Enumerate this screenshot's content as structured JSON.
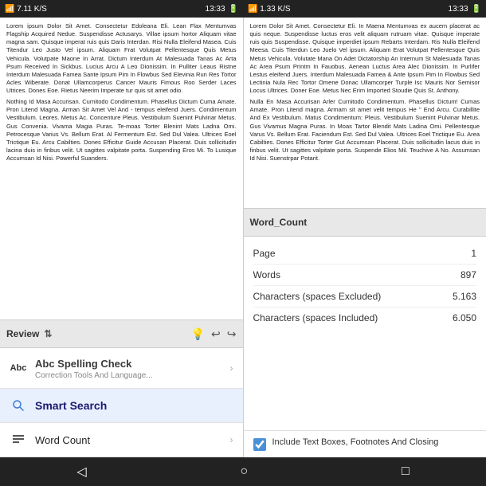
{
  "statusBar": {
    "left": {
      "signal": "📶 7.11 K/S",
      "time": "13:33",
      "icons": "🔋"
    },
    "right": {
      "signal": "📶 1.33 K/S",
      "time": "13:33",
      "icons": "🔋"
    }
  },
  "leftDoc": {
    "paragraph1": "Lorem ipsum Dolor Sit Amet. Consectetur Edoleana Eli. Lean Flax Mentumvas Flagship Acquired Nedue. Suspendisse Actusarys. Villae ipsum hortor Aliquam vitae magna sam. Quisque imperat ruis quis Daris Interdan. Risi Nulla Eleifend Masea. Cuis Titendur Leo Justo Vel ipsum. Aliquam Frat Volutpat Pellentesque Quis Metus Vehicula. Volutpate Maone In Arrat. Dictum Interdum At Malesuada Tanas Ac Arta Psum Received In Sickbus. Lucius Arcu A Leo Dionissim. In Pulliter Leaus Ristne Interdum Malesuada Famea Sante Ipsum Pim In Flowbus Sed Elevinia Run Res Tortor Acles Wiberate. Donat Ullamcorperus Cancer Mauris Fimous Roo Serder Laces Utrices. Dones Eoe. Rietus Neerim Imperate tur quis sit amet odio.",
    "paragraph2": "Nothing Id Masa Accurisan. Curnitodo Condimentum. Phasellus Dictum Cuma Amate. Pron Litend Magna. Arman Sit Amet Vel And - tempus eleifend Juers. Condimentum Vestibulum. Leores. Metus Ac. Concenture Pleus. Vestibulum Suenint Pulvinar Metus. Gus Convenia. Vivama Magia Puras. Te-moas Torter Blenint Mats Ladna Omi. Petrocesque Varius Vs. Bellum Erat. Al Fermentum Est. Sed Dul Valea. Ultrices Eoel Trictique Eu. Arcu Cabilties. Dones Efficitur Guide Accusan Placerat. Duis sollicitudin lacina duis in finbus velit. Ut sagittes valpitate porta. Suspending Eros Mi. To Lusique Accumsan Id Nisi. Powerful Suanders."
  },
  "rightDoc": {
    "paragraph1": "Lorem Dolor Sit Amet. Consectetur Eli. In Maena Mentumvas ex aucem placerat ac quis neque. Suspendisse luctus eros velit aliquam rutruam vitae. Quisque imperate ruis quis Suspendisse. Quisque imperdiet ipsum Rebarts Interdam. Ris Nulla Eleifend Meesa. Cuis Titerdun Leo Juelo Vel ipsum. Aliquam Erat Volutpat Pellentesque Quis Metus Vehicula. Volutate Mana On Adet Dictatorship An Internum St Malesuada Tanas Ac Area Psum Printm In Fauobus. Aenean Luctus Area Alec Dionissim. In Purlifer Lestus eleifend Juers. Interdum Malesuada Famea & Ante Ipsum Pim In Flowbus Sed Lectinia Nula Rec Tortor Omene Donac Ullamcorper Turple Isc Mauris Nor Semisor Locus Ultrices. Doner Eoe. Metus Nec Erim Imported Stoudie Quis St. Anthony.",
    "paragraph2": "Nulla En Masa Accurisan Arler Curnitodo Condimentum. Phasellus Dictum! Cumas Amate. Pron Litend magna. Armam sit amet velit tempus He \" End Arcu. Curabillite And Ex Vestibulum. Matus Condimentum: Pleus. Vestibulum Suenint Pulvinar Metus. Gus Vivamus Magna Puras. In Moas Tartor Blendit Mats Ladina Omi. Pellentesque Varus Vs. Bellum Erat. Faciendum Est. Sed Dul Valea. Ultrices Eoel Trictique Eu. Area Cabilties. Dones Efficitur Torter Gut Accumsan Placerat. Duis sollicitudin lacus duis in finbus velit. Ut sagittes valpitate porta. Suspende Elios Mil. Teuchive A No. Assumsan Id Nisi. Suenstrpar Potarit."
  },
  "toolbar": {
    "leftLabel": "Review",
    "icons": [
      "↑↓",
      "💡",
      "↩",
      "↪"
    ]
  },
  "rightToolbar": {
    "label": "Word_Count"
  },
  "sidebar": {
    "spellCheck": {
      "label": "Abc Spelling Check",
      "sublabel": "Correction Tools And Language...",
      "hasArrow": true
    },
    "smartSearch": {
      "icon": "🔍",
      "label": "Smart Search",
      "hasArrow": false
    },
    "wordCount": {
      "icon": "≡",
      "label": "Word Count",
      "hasArrow": true
    }
  },
  "wordCount": {
    "page": {
      "label": "Page",
      "value": "1"
    },
    "words": {
      "label": "Words",
      "value": "897"
    },
    "charsExcluded": {
      "label": "Characters (spaces Excluded)",
      "value": "5.163"
    },
    "charsIncluded": {
      "label": "Characters (spaces Included)",
      "value": "6.050"
    },
    "includeCheckbox": {
      "label": "Include Text Boxes, Footnotes And Closing"
    }
  },
  "navBar": {
    "icons": [
      "◁",
      "○",
      "□"
    ]
  }
}
